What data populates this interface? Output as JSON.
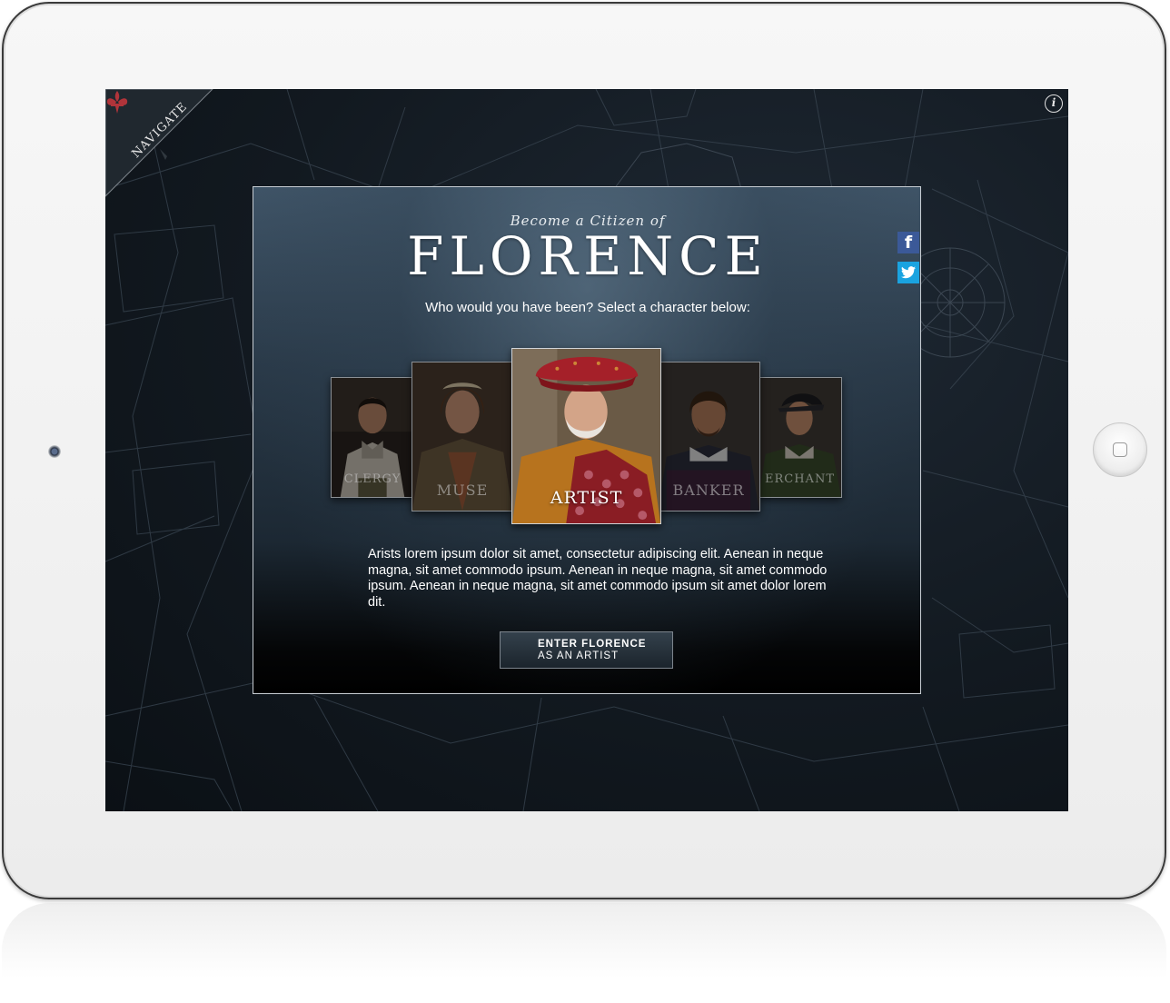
{
  "app": {
    "nav_label": "NAVIGATE",
    "info_label": "i"
  },
  "modal": {
    "subtitle": "Become a Citizen of",
    "title": "FLORENCE",
    "prompt": "Who would you have been? Select a character below:",
    "description": "Arists lorem ipsum dolor sit amet, consectetur adipiscing elit. Aenean in neque magna, sit amet commodo ipsum. Aenean in neque magna, sit amet commodo ipsum. Aenean in neque magna, sit amet commodo ipsum sit amet dolor lorem dit.",
    "enter_button": {
      "line1": "ENTER FLORENCE",
      "line2": "AS AN ARTIST"
    }
  },
  "characters": [
    {
      "label": "CLERGY",
      "selected": false
    },
    {
      "label": "MUSE",
      "selected": false
    },
    {
      "label": "ARTIST",
      "selected": true
    },
    {
      "label": "BANKER",
      "selected": false
    },
    {
      "label": "ERCHANT",
      "selected": false
    }
  ],
  "social": {
    "facebook_glyph": "f"
  },
  "colors": {
    "facebook": "#3b5998",
    "twitter": "#1aa3e0",
    "fleur": "#b0343a"
  }
}
